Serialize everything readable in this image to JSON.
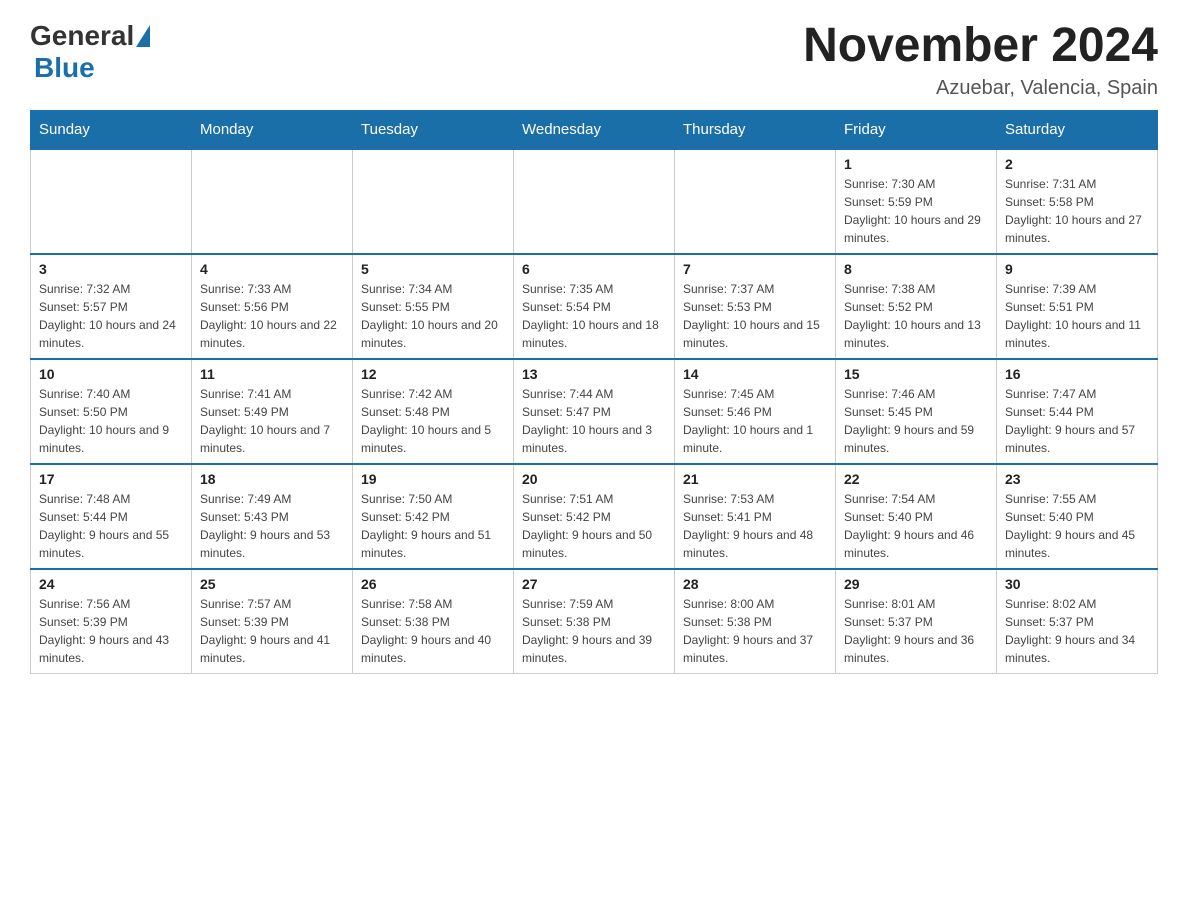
{
  "header": {
    "logo_general": "General",
    "logo_blue": "Blue",
    "month_year": "November 2024",
    "location": "Azuebar, Valencia, Spain"
  },
  "weekdays": [
    "Sunday",
    "Monday",
    "Tuesday",
    "Wednesday",
    "Thursday",
    "Friday",
    "Saturday"
  ],
  "weeks": [
    [
      {
        "day": "",
        "info": ""
      },
      {
        "day": "",
        "info": ""
      },
      {
        "day": "",
        "info": ""
      },
      {
        "day": "",
        "info": ""
      },
      {
        "day": "",
        "info": ""
      },
      {
        "day": "1",
        "info": "Sunrise: 7:30 AM\nSunset: 5:59 PM\nDaylight: 10 hours and 29 minutes."
      },
      {
        "day": "2",
        "info": "Sunrise: 7:31 AM\nSunset: 5:58 PM\nDaylight: 10 hours and 27 minutes."
      }
    ],
    [
      {
        "day": "3",
        "info": "Sunrise: 7:32 AM\nSunset: 5:57 PM\nDaylight: 10 hours and 24 minutes."
      },
      {
        "day": "4",
        "info": "Sunrise: 7:33 AM\nSunset: 5:56 PM\nDaylight: 10 hours and 22 minutes."
      },
      {
        "day": "5",
        "info": "Sunrise: 7:34 AM\nSunset: 5:55 PM\nDaylight: 10 hours and 20 minutes."
      },
      {
        "day": "6",
        "info": "Sunrise: 7:35 AM\nSunset: 5:54 PM\nDaylight: 10 hours and 18 minutes."
      },
      {
        "day": "7",
        "info": "Sunrise: 7:37 AM\nSunset: 5:53 PM\nDaylight: 10 hours and 15 minutes."
      },
      {
        "day": "8",
        "info": "Sunrise: 7:38 AM\nSunset: 5:52 PM\nDaylight: 10 hours and 13 minutes."
      },
      {
        "day": "9",
        "info": "Sunrise: 7:39 AM\nSunset: 5:51 PM\nDaylight: 10 hours and 11 minutes."
      }
    ],
    [
      {
        "day": "10",
        "info": "Sunrise: 7:40 AM\nSunset: 5:50 PM\nDaylight: 10 hours and 9 minutes."
      },
      {
        "day": "11",
        "info": "Sunrise: 7:41 AM\nSunset: 5:49 PM\nDaylight: 10 hours and 7 minutes."
      },
      {
        "day": "12",
        "info": "Sunrise: 7:42 AM\nSunset: 5:48 PM\nDaylight: 10 hours and 5 minutes."
      },
      {
        "day": "13",
        "info": "Sunrise: 7:44 AM\nSunset: 5:47 PM\nDaylight: 10 hours and 3 minutes."
      },
      {
        "day": "14",
        "info": "Sunrise: 7:45 AM\nSunset: 5:46 PM\nDaylight: 10 hours and 1 minute."
      },
      {
        "day": "15",
        "info": "Sunrise: 7:46 AM\nSunset: 5:45 PM\nDaylight: 9 hours and 59 minutes."
      },
      {
        "day": "16",
        "info": "Sunrise: 7:47 AM\nSunset: 5:44 PM\nDaylight: 9 hours and 57 minutes."
      }
    ],
    [
      {
        "day": "17",
        "info": "Sunrise: 7:48 AM\nSunset: 5:44 PM\nDaylight: 9 hours and 55 minutes."
      },
      {
        "day": "18",
        "info": "Sunrise: 7:49 AM\nSunset: 5:43 PM\nDaylight: 9 hours and 53 minutes."
      },
      {
        "day": "19",
        "info": "Sunrise: 7:50 AM\nSunset: 5:42 PM\nDaylight: 9 hours and 51 minutes."
      },
      {
        "day": "20",
        "info": "Sunrise: 7:51 AM\nSunset: 5:42 PM\nDaylight: 9 hours and 50 minutes."
      },
      {
        "day": "21",
        "info": "Sunrise: 7:53 AM\nSunset: 5:41 PM\nDaylight: 9 hours and 48 minutes."
      },
      {
        "day": "22",
        "info": "Sunrise: 7:54 AM\nSunset: 5:40 PM\nDaylight: 9 hours and 46 minutes."
      },
      {
        "day": "23",
        "info": "Sunrise: 7:55 AM\nSunset: 5:40 PM\nDaylight: 9 hours and 45 minutes."
      }
    ],
    [
      {
        "day": "24",
        "info": "Sunrise: 7:56 AM\nSunset: 5:39 PM\nDaylight: 9 hours and 43 minutes."
      },
      {
        "day": "25",
        "info": "Sunrise: 7:57 AM\nSunset: 5:39 PM\nDaylight: 9 hours and 41 minutes."
      },
      {
        "day": "26",
        "info": "Sunrise: 7:58 AM\nSunset: 5:38 PM\nDaylight: 9 hours and 40 minutes."
      },
      {
        "day": "27",
        "info": "Sunrise: 7:59 AM\nSunset: 5:38 PM\nDaylight: 9 hours and 39 minutes."
      },
      {
        "day": "28",
        "info": "Sunrise: 8:00 AM\nSunset: 5:38 PM\nDaylight: 9 hours and 37 minutes."
      },
      {
        "day": "29",
        "info": "Sunrise: 8:01 AM\nSunset: 5:37 PM\nDaylight: 9 hours and 36 minutes."
      },
      {
        "day": "30",
        "info": "Sunrise: 8:02 AM\nSunset: 5:37 PM\nDaylight: 9 hours and 34 minutes."
      }
    ]
  ]
}
